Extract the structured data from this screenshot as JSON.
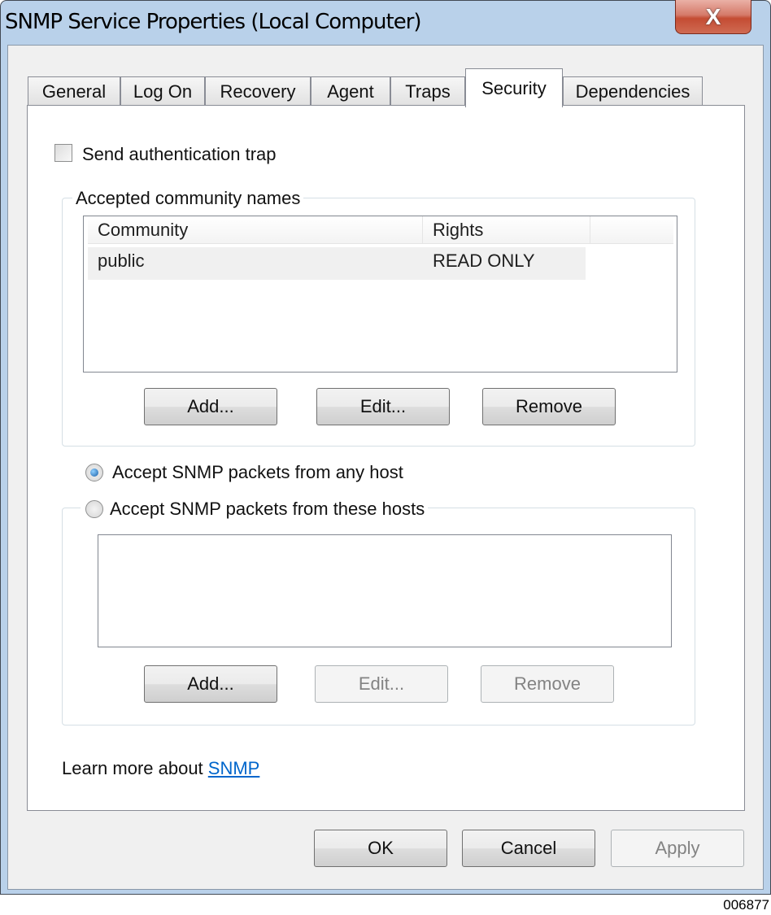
{
  "window": {
    "title": "SNMP Service Properties (Local Computer)",
    "close_glyph": "X"
  },
  "tabs": [
    {
      "label": "General",
      "active": false
    },
    {
      "label": "Log On",
      "active": false
    },
    {
      "label": "Recovery",
      "active": false
    },
    {
      "label": "Agent",
      "active": false
    },
    {
      "label": "Traps",
      "active": false
    },
    {
      "label": "Security",
      "active": true
    },
    {
      "label": "Dependencies",
      "active": false
    }
  ],
  "security": {
    "send_auth_trap": {
      "label": "Send authentication trap",
      "checked": false
    },
    "communities": {
      "legend": "Accepted community names",
      "columns": [
        "Community",
        "Rights"
      ],
      "rows": [
        {
          "community": "public",
          "rights": "READ ONLY"
        }
      ],
      "buttons": {
        "add": "Add...",
        "edit": "Edit...",
        "remove": "Remove"
      }
    },
    "accept_any": {
      "label": "Accept SNMP packets from any host",
      "selected": true
    },
    "accept_these": {
      "label": "Accept SNMP packets from these hosts",
      "selected": false
    },
    "hosts": {
      "items": [],
      "buttons": {
        "add": "Add...",
        "edit": "Edit...",
        "remove": "Remove"
      }
    },
    "learn_more": {
      "prefix": "Learn more about ",
      "link": "SNMP"
    }
  },
  "footer": {
    "ok": "OK",
    "cancel": "Cancel",
    "apply": "Apply"
  },
  "figure_id": "006877"
}
